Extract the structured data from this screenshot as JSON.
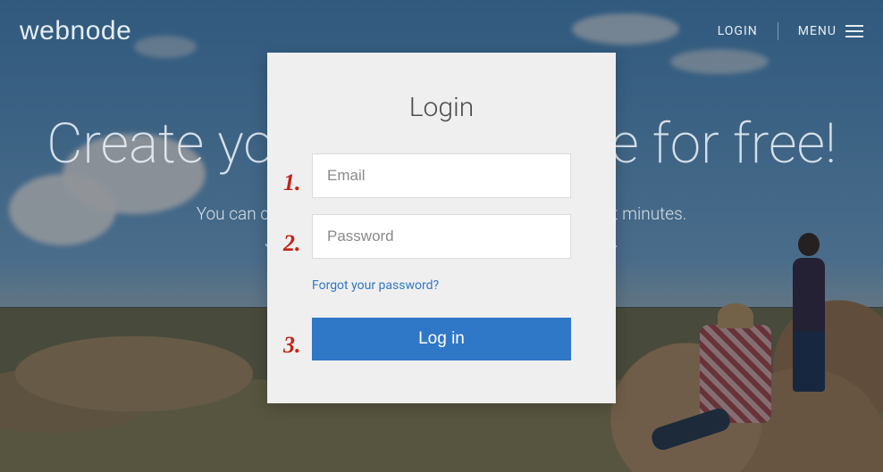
{
  "brand": "webnode",
  "nav": {
    "login": "LOGIN",
    "menu": "MENU"
  },
  "hero": {
    "headline": "Create your own website for free!",
    "sub1": "You can create an amazing website with Webnode in just minutes.",
    "sub2": "Join our 30 million users and build one yourself."
  },
  "login": {
    "title": "Login",
    "email_placeholder": "Email",
    "password_placeholder": "Password",
    "forgot": "Forgot your password?",
    "submit": "Log in"
  },
  "annotations": {
    "a1": "1.",
    "a2": "2.",
    "a3": "3."
  },
  "colors": {
    "primary": "#2f77c7",
    "annotation": "#c22417"
  }
}
